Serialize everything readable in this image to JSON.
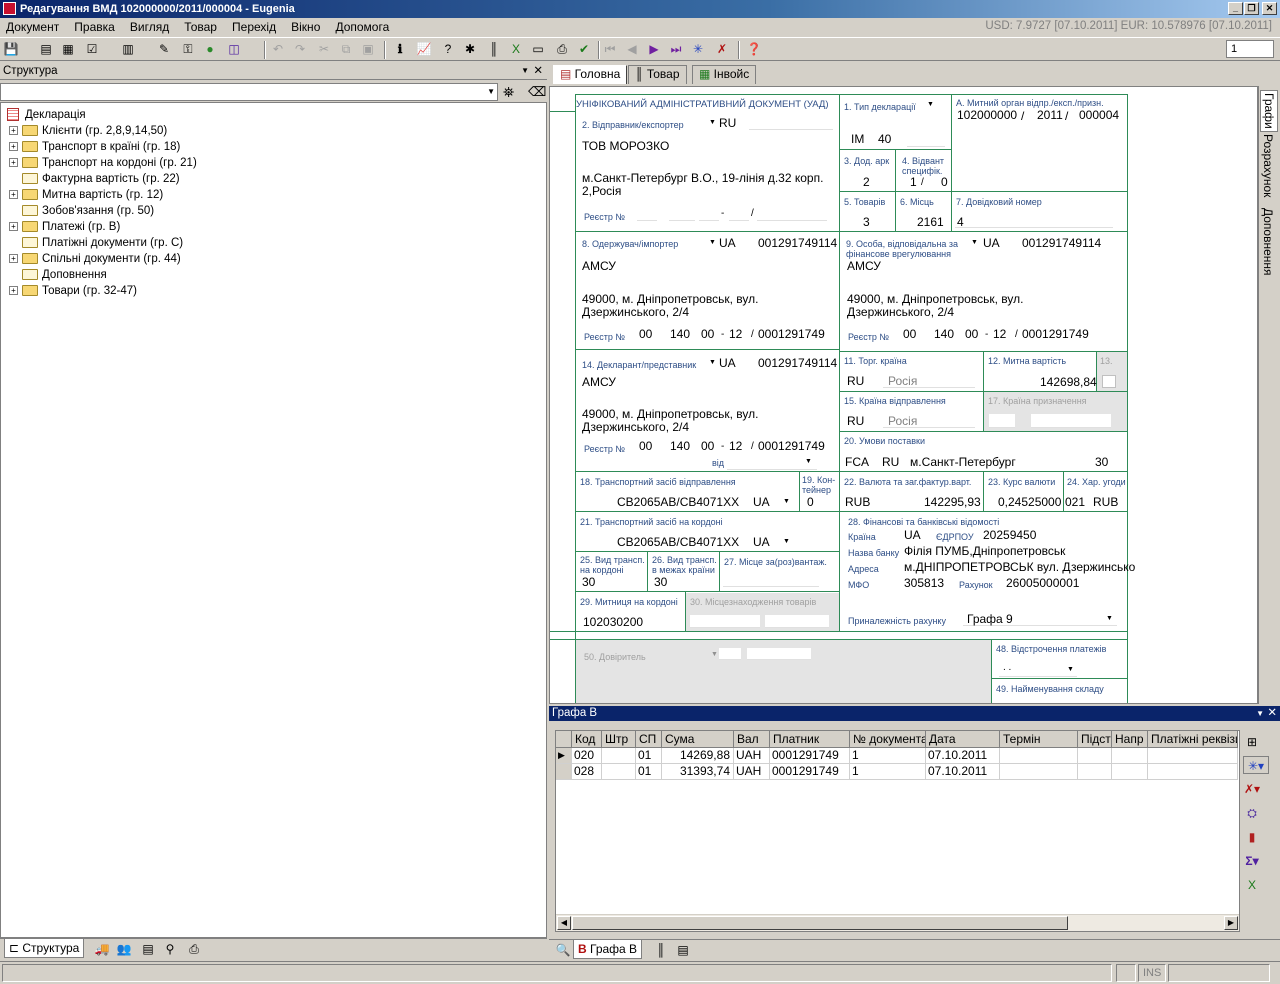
{
  "window": {
    "title": "Редагування ВМД 102000000/2011/000004 - Eugenia"
  },
  "menu": [
    "Документ",
    "Правка",
    "Вигляд",
    "Товар",
    "Перехід",
    "Вікно",
    "Допомога"
  ],
  "rates": "USD: 7.9727 [07.10.2011] EUR: 10.578976 [07.10.2011]",
  "toolbar": {
    "counter": "1"
  },
  "structure": {
    "title": "Структура",
    "root": "Декларація",
    "items": [
      {
        "label": "Клієнти (гр. 2,8,9,14,50)",
        "expandable": true
      },
      {
        "label": "Транспорт в країні (гр. 18)",
        "expandable": true
      },
      {
        "label": "Транспорт на кордоні (гр. 21)",
        "expandable": true
      },
      {
        "label": "Фактурна вартість (гр. 22)",
        "expandable": false
      },
      {
        "label": "Митна вартість (гр. 12)",
        "expandable": true
      },
      {
        "label": "Зобов'язання (гр. 50)",
        "expandable": false
      },
      {
        "label": "Платежі (гр. B)",
        "expandable": true
      },
      {
        "label": "Платіжні документи (гр. C)",
        "expandable": false
      },
      {
        "label": "Спільні документи (гр. 44)",
        "expandable": true
      },
      {
        "label": "Доповнення",
        "expandable": false
      },
      {
        "label": "Товари (гр. 32-47)",
        "expandable": true
      }
    ],
    "bottom_tab": "Структура"
  },
  "tabs": [
    "Головна",
    "Товар",
    "Інвойс"
  ],
  "side_tabs": [
    "Графи",
    "Розрахунок",
    "Доповнення"
  ],
  "form": {
    "header": "УНІФІКОВАНИЙ АДМІНІСТРАТИВНИЙ ДОКУМЕНТ (УАД)",
    "g1_label": "1. Тип декларації",
    "g1_a": "ІМ",
    "g1_b": "40",
    "gA_label": "А. Митний орган відпр./експ./призн.",
    "gA_1": "102000000",
    "gA_sep1": "/",
    "gA_2": "2011",
    "gA_sep2": "/",
    "gA_3": "000004",
    "g2_label": "2. Відправник/експортер",
    "g2_country": "RU",
    "g2_name": "ТОВ МОРОЗКО",
    "g2_addr1": "м.Санкт-Петербург В.О., 19-лінія д.32 корп.",
    "g2_addr2": "2,Росія",
    "reestr": "Реєстр №",
    "g3_label": "3. Дод. арк",
    "g3_val": "2",
    "g4_label": "4. Відвант специфік.",
    "g4_val1": "1",
    "g4_sep": "/",
    "g4_val2": "0",
    "g5_label": "5. Товарів",
    "g5_val": "3",
    "g6_label": "6. Місць",
    "g6_val": "2161",
    "g7_label": "7. Довідковий номер",
    "g7_val": "4",
    "g8_label": "8. Одержувач/імпортер",
    "g8_country": "UA",
    "g8_code": "001291749114",
    "g8_name": "АМСУ",
    "g8_addr1": "49000, м. Дніпропетровськ, вул.",
    "g8_addr2": "Дзержинського, 2/4",
    "g9_label": "9. Особа, відповідальна за фінансове врегулювання",
    "g9_country": "UA",
    "g9_code": "001291749114",
    "g9_name": "АМСУ",
    "g9_addr1": "49000, м. Дніпропетровськ, вул.",
    "g9_addr2": "Дзержинського, 2/4",
    "reg_a": "00",
    "reg_b": "140",
    "reg_c": "00",
    "reg_dash": "-",
    "reg_d": "12",
    "reg_slash": "/",
    "reg_e": "0001291749",
    "g14_label": "14. Декларант/представник",
    "g14_country": "UA",
    "g14_code": "001291749114",
    "g14_name": "АМСУ",
    "g14_addr1": "49000, м. Дніпропетровськ, вул.",
    "g14_addr2": "Дзержинського, 2/4",
    "g14_vid": "від",
    "g11_label": "11. Торг. країна",
    "g11_code": "RU",
    "g11_name": "Росія",
    "g12_label": "12. Митна вартість",
    "g12_val": "142698,84",
    "g13_label": "13.",
    "g15_label": "15. Країна відправлення",
    "g15_code": "RU",
    "g15_name": "Росія",
    "g17_label": "17. Країна призначення",
    "g20_label": "20. Умови поставки",
    "g20_a": "FCA",
    "g20_b": "RU",
    "g20_c": "м.Санкт-Петербург",
    "g20_d": "30",
    "g18_label": "18. Транспортний засіб відправлення",
    "g18_val": "СВ2065АВ/СВ4071ХХ",
    "g18_country": "UA",
    "g19_label": "19. Кон-тейнер",
    "g19_val": "0",
    "g22_label": "22. Валюта та заг.фактур.варт.",
    "g22_cur": "RUB",
    "g22_val": "142295,93",
    "g23_label": "23. Курс валюти",
    "g23_val": "0,24525000",
    "g24_label": "24. Хар. угоди",
    "g24_a": "021",
    "g24_b": "RUB",
    "g21_label": "21. Транспортний засіб на кордоні",
    "g21_val": "СВ2065АВ/СВ4071ХХ",
    "g21_country": "UA",
    "g28_label": "28. Фінансові та банківські відомості",
    "g28_country_lbl": "Країна",
    "g28_country": "UA",
    "g28_edrpou_lbl": "ЄДРПОУ",
    "g28_edrpou": "20259450",
    "g28_bank_lbl": "Назва банку",
    "g28_bank": "Філія ПУМБ,Дніпропетровськ",
    "g28_addr_lbl": "Адреса",
    "g28_addr": "м.ДНІПРОПЕТРОВСЬК вул. Дзержинсько",
    "g28_mfo_lbl": "МФО",
    "g28_mfo": "305813",
    "g28_acc_lbl": "Рахунок",
    "g28_acc": "26005000001",
    "g28_belong_lbl": "Приналежність рахунку",
    "g28_belong": "Графа 9",
    "g25_label": "25. Вид трансп. на кордоні",
    "g25_val": "30",
    "g26_label": "26. Вид трансп. в межах країни",
    "g26_val": "30",
    "g27_label": "27. Місце за(роз)вантаж.",
    "g29_label": "29. Митниця на кордоні",
    "g29_val": "102030200",
    "g30_label": "30. Місцезнаходження товарів",
    "g50_label": "50. Довіритель",
    "g48_label": "48. Відстрочення платежів",
    "g48_val": ". .",
    "g49_label": "49. Найменування складу"
  },
  "grafa_b": {
    "title": "Графа B",
    "columns": [
      "Код",
      "Штр",
      "СП",
      "Сума",
      "Вал",
      "Платник",
      "№ документа",
      "Дата",
      "Термін",
      "Підст",
      "Напр",
      "Платіжні реквізи"
    ],
    "rows": [
      [
        "020",
        "",
        "01",
        "14269,88",
        "UAH",
        "0001291749",
        "1",
        "07.10.2011",
        "",
        "",
        "",
        ""
      ],
      [
        "028",
        "",
        "01",
        "31393,74",
        "UAH",
        "0001291749",
        "1",
        "07.10.2011",
        "",
        "",
        "",
        ""
      ]
    ],
    "bottom_tab": "Графа B"
  },
  "status": {
    "ins": "INS"
  }
}
